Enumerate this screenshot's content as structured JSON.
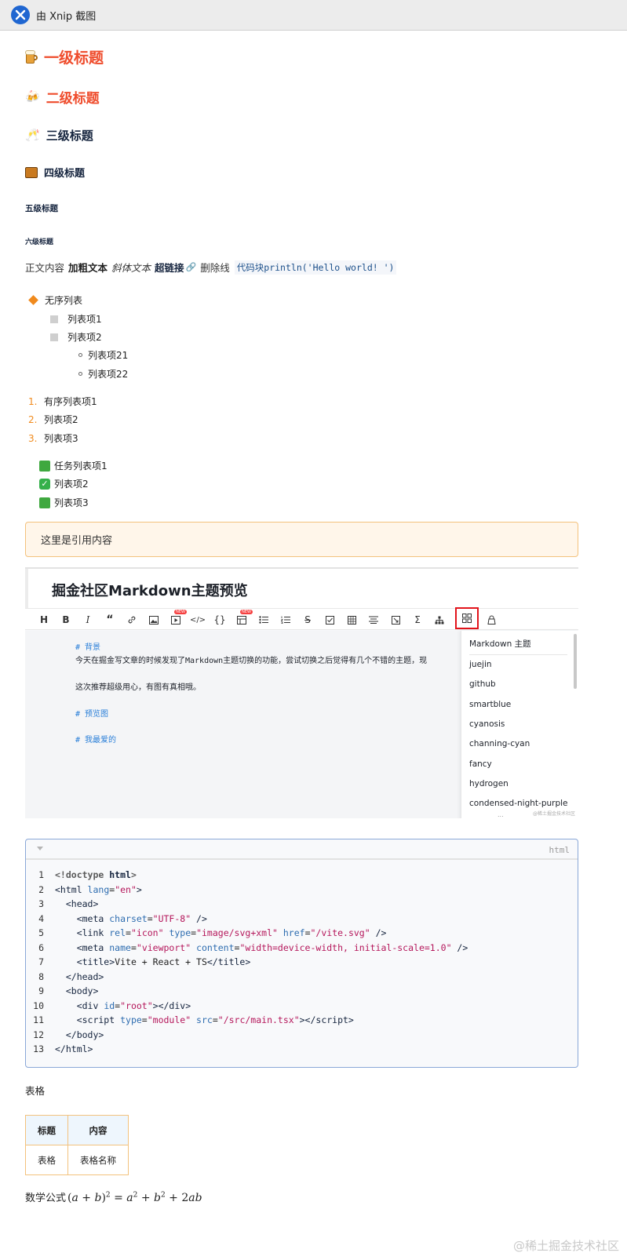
{
  "window": {
    "title": "由 Xnip 截图"
  },
  "headings": {
    "h1": "一级标题",
    "h2": "二级标题",
    "h3": "三级标题",
    "h4": "四级标题",
    "h5": "五级标题",
    "h6": "六级标题"
  },
  "paragraph": {
    "plain": "正文内容",
    "bold": "加粗文本",
    "italic": "斜体文本",
    "link": "超链接",
    "strike": "删除线",
    "code": "代码块println('Hello world! ')"
  },
  "unordered_list": {
    "top": "无序列表",
    "items": [
      "列表项1",
      "列表项2"
    ],
    "nested": [
      "列表项21",
      "列表项22"
    ]
  },
  "ordered_list": {
    "numbers": [
      "1.",
      "2.",
      "3."
    ],
    "items": [
      "有序列表项1",
      "列表项2",
      "列表项3"
    ]
  },
  "task_list": [
    "任务列表项1",
    "列表项2",
    "列表项3"
  ],
  "task_check": "✓",
  "blockquote": "这里是引用内容",
  "screenshot": {
    "title": "掘金社区Markdown主题预览",
    "toolbar": [
      "H",
      "B",
      "I",
      "“",
      "link",
      "image",
      "video",
      "code",
      "{}",
      "table-new",
      "ul",
      "ol",
      "strike",
      "task",
      "grid",
      "align",
      "fullscreen",
      "Σ",
      "tree",
      "theme",
      "lock"
    ],
    "badge": "NEW",
    "editor": {
      "line1": "# 背景",
      "line2": "今天在掘金写文章的时候发现了Markdown主题切换的功能，尝试切换之后觉得有几个不错的主题，现",
      "line3": "这次推荐超级用心，有图有真相哦。",
      "line4": "# 预览图",
      "line5": "# 我最爱的"
    },
    "menu_title": "Markdown 主题",
    "themes": [
      "juejin",
      "github",
      "smartblue",
      "cyanosis",
      "channing-cyan",
      "fancy",
      "hydrogen",
      "condensed-night-purple"
    ],
    "menu_more": "...",
    "watermark": "@稀土掘金技术社区"
  },
  "code_block": {
    "language": "html",
    "lines": [
      {
        "n": "1"
      },
      {
        "n": "2"
      },
      {
        "n": "3"
      },
      {
        "n": "4"
      },
      {
        "n": "5"
      },
      {
        "n": "6"
      },
      {
        "n": "7"
      },
      {
        "n": "8"
      },
      {
        "n": "9"
      },
      {
        "n": "10"
      },
      {
        "n": "11"
      },
      {
        "n": "12"
      },
      {
        "n": "13"
      }
    ]
  },
  "table_label": "表格",
  "table": {
    "headers": [
      "标题",
      "内容"
    ],
    "rows": [
      [
        "表格",
        "表格名称"
      ]
    ]
  },
  "math": {
    "label": "数学公式"
  },
  "watermark": "@稀土掘金技术社区",
  "colors": {
    "heading_red": "#ef4c2c",
    "heading_navy": "#14233d",
    "accent_orange": "#f08a1d",
    "quote_border": "#f3c27d",
    "code_border": "#8aa8d8",
    "selected_red": "#e2141b"
  }
}
